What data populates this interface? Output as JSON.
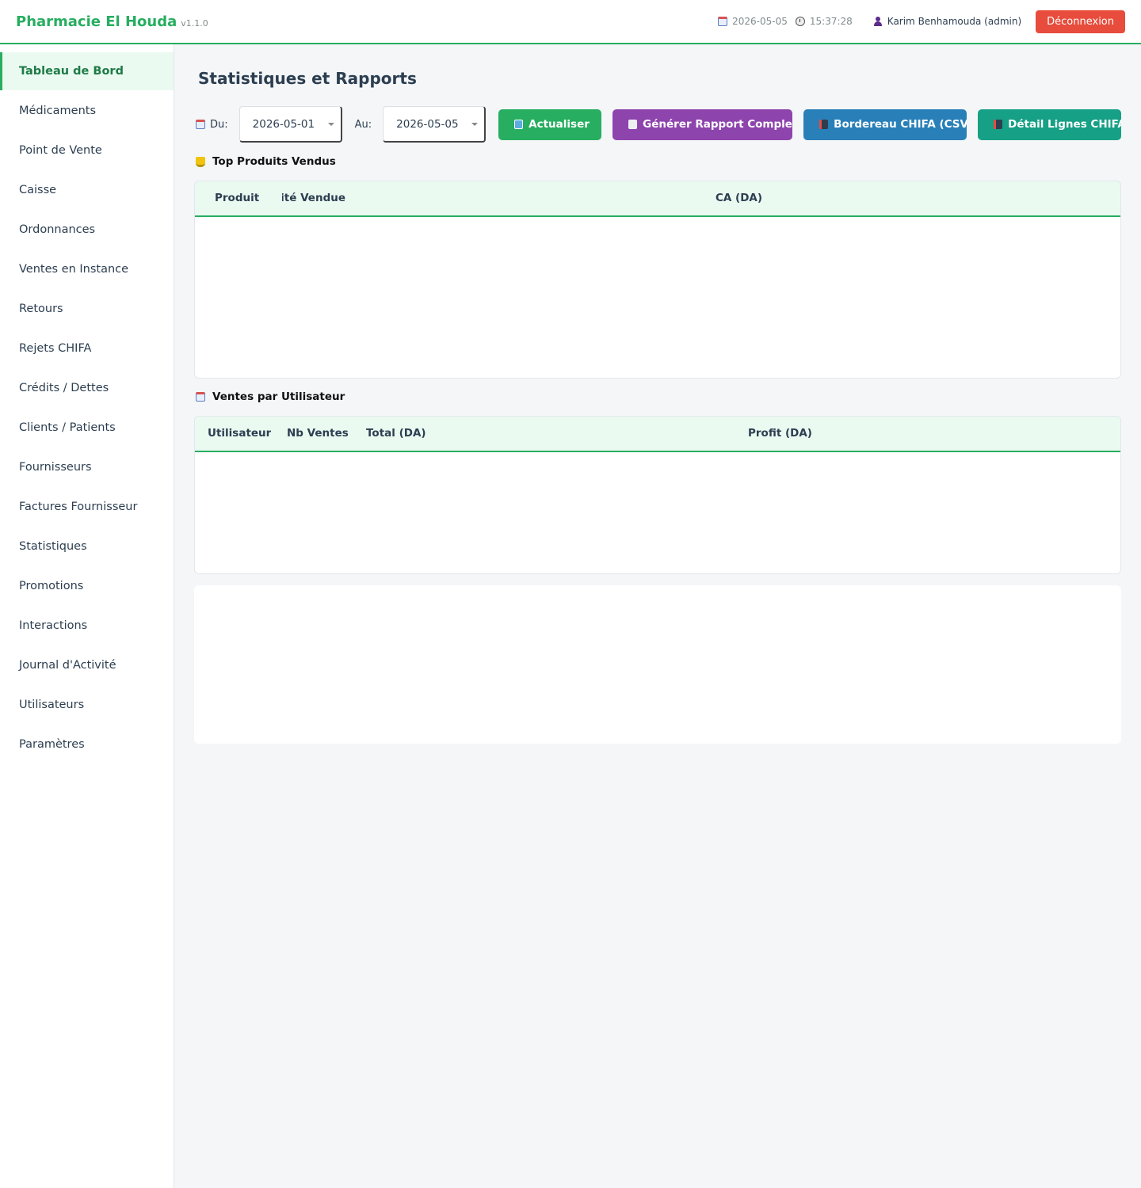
{
  "header": {
    "brand": "Pharmacie El Houda",
    "version": "v1.1.0",
    "date": "2026-05-05",
    "time": "15:37:28",
    "user": "Karim Benhamouda (admin)",
    "logout_label": "Déconnexion"
  },
  "sidebar": {
    "items": [
      {
        "label": "Tableau de Bord"
      },
      {
        "label": "Médicaments"
      },
      {
        "label": "Point de Vente"
      },
      {
        "label": "Caisse"
      },
      {
        "label": "Ordonnances"
      },
      {
        "label": "Ventes en Instance"
      },
      {
        "label": "Retours"
      },
      {
        "label": "Rejets CHIFA"
      },
      {
        "label": "Crédits / Dettes"
      },
      {
        "label": "Clients / Patients"
      },
      {
        "label": "Fournisseurs"
      },
      {
        "label": "Factures Fournisseur"
      },
      {
        "label": "Statistiques"
      },
      {
        "label": "Promotions"
      },
      {
        "label": "Interactions"
      },
      {
        "label": "Journal d'Activité"
      },
      {
        "label": "Utilisateurs"
      },
      {
        "label": "Paramètres"
      }
    ]
  },
  "main": {
    "title": "Statistiques et Rapports",
    "filters": {
      "from_label": "Du:",
      "from_value": "2026-05-01",
      "to_label": "Au:",
      "to_value": "2026-05-05"
    },
    "buttons": {
      "refresh": "Actualiser",
      "report": "Générer Rapport Complet",
      "chifa_csv": "Bordereau CHIFA (CSV)",
      "chifa_lines": "Détail Lignes CHIFA"
    },
    "top_products": {
      "title": "Top Produits Vendus",
      "columns": [
        "Produit",
        "Quantité Vendue",
        "CA (DA)"
      ]
    },
    "sales_by_user": {
      "title": "Ventes par Utilisateur",
      "columns": [
        "Utilisateur",
        "Nb Ventes",
        "Total (DA)",
        "Profit (DA)"
      ]
    }
  }
}
